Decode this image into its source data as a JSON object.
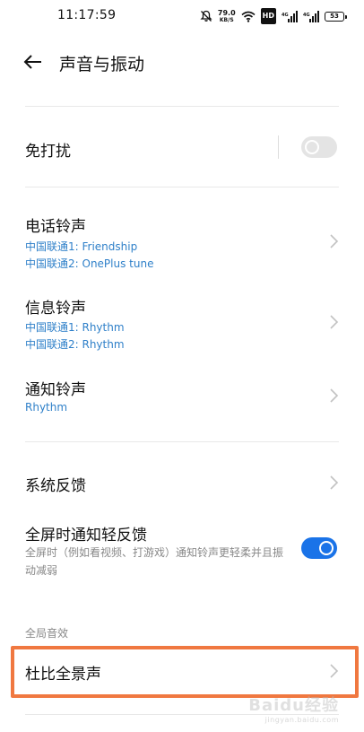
{
  "status_bar": {
    "time": "11:17:59",
    "net_speed_value": "79.0",
    "net_speed_unit": "KB/S",
    "hd_badge": "HD",
    "battery": "53"
  },
  "header": {
    "title": "声音与振动",
    "back_icon": "arrow-left-icon"
  },
  "dnd": {
    "label": "免打扰",
    "enabled": false
  },
  "ringtones": {
    "phone": {
      "label": "电话铃声",
      "lines": [
        "中国联通1: Friendship",
        "中国联通2: OnePlus tune"
      ]
    },
    "message": {
      "label": "信息铃声",
      "lines": [
        "中国联通1: Rhythm",
        "中国联通2: Rhythm"
      ]
    },
    "notification": {
      "label": "通知铃声",
      "lines": [
        "Rhythm"
      ]
    }
  },
  "feedback": {
    "label": "系统反馈"
  },
  "fullscreen_feedback": {
    "label": "全屏时通知轻反馈",
    "description": "全屏时（例如看视频、打游戏）通知铃声更轻柔并且振动减弱",
    "enabled": true
  },
  "global_audio": {
    "section_label": "全局音效",
    "dolby_label": "杜比全景声"
  },
  "watermark": {
    "logo": "Baidu经验",
    "url": "jingyan.baidu.com"
  },
  "colors": {
    "accent": "#1a73e8",
    "subtext_blue": "#2f80c9",
    "highlight": "#f07840"
  }
}
